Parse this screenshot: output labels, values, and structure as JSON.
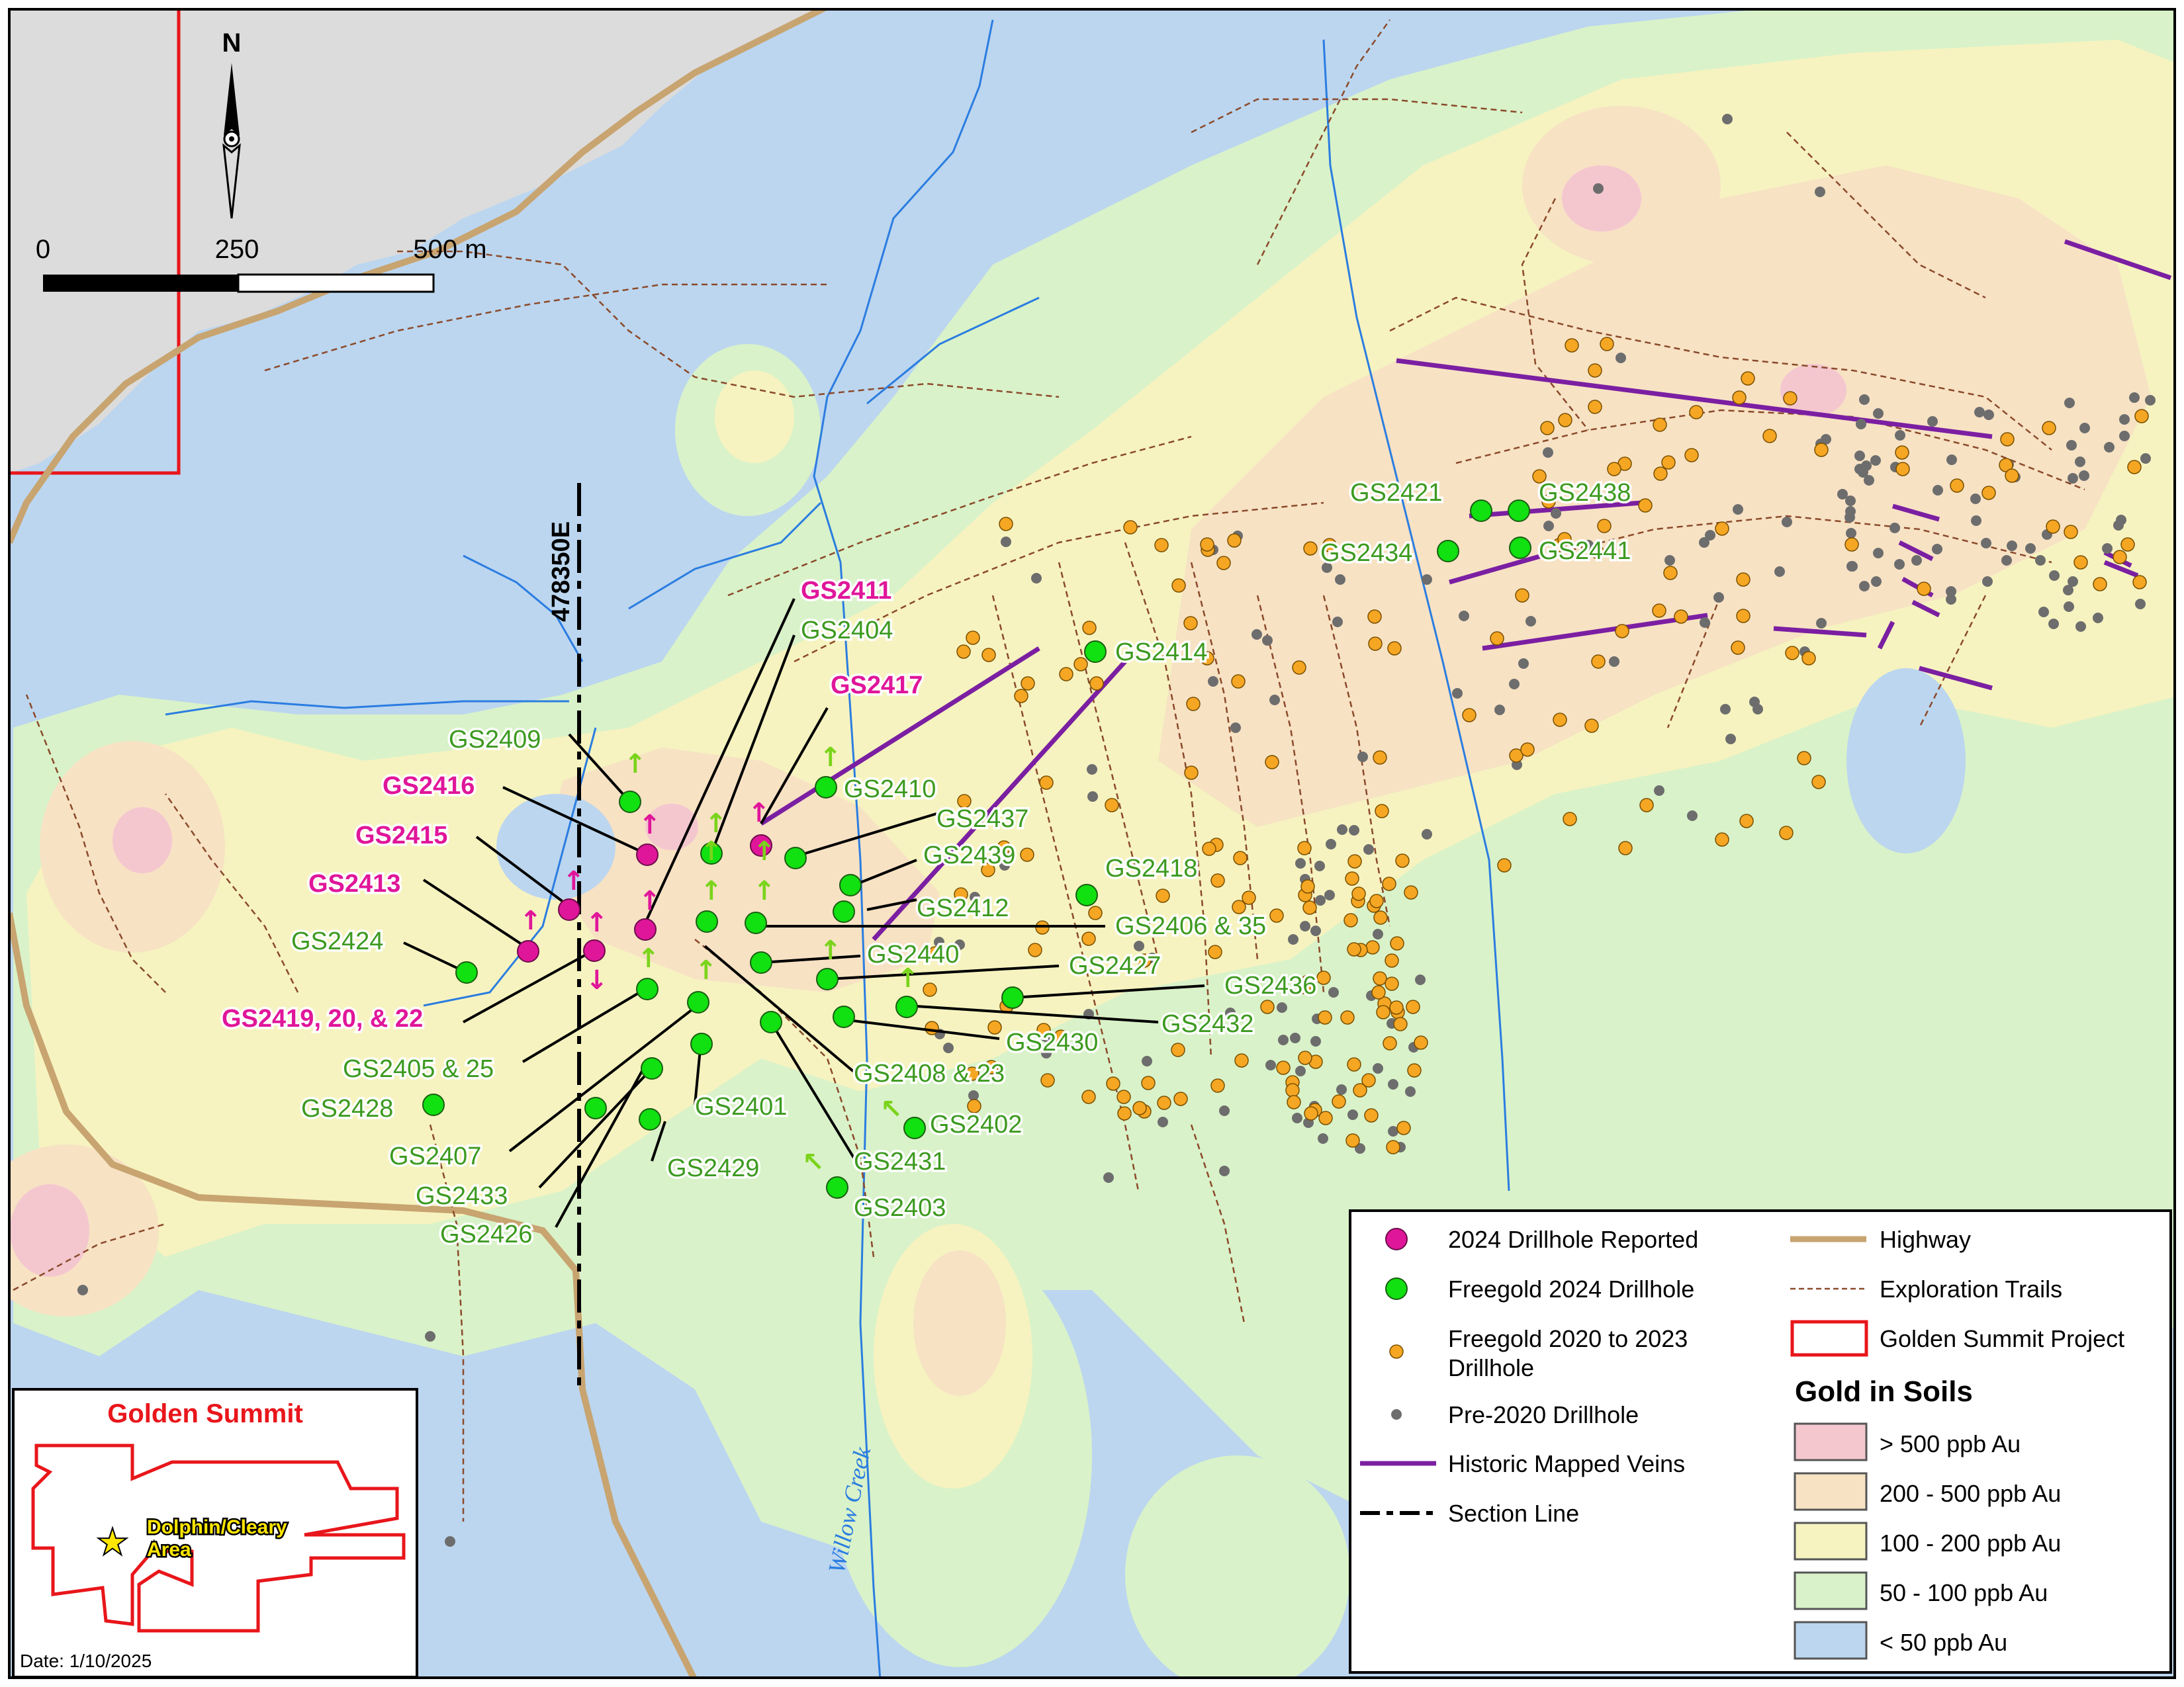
{
  "map": {
    "north_label": "N",
    "scale": {
      "t0": "0",
      "t1": "250",
      "t2": "500 m"
    },
    "section_label": "478350E",
    "creek_label": "Willow Creek"
  },
  "drillholes_2024_reported": [
    {
      "label": "GS2411"
    },
    {
      "label": "GS2417"
    },
    {
      "label": "GS2416"
    },
    {
      "label": "GS2415"
    },
    {
      "label": "GS2413"
    },
    {
      "label": "GS2419, 20, & 22"
    }
  ],
  "drillholes_freegold_2024": [
    {
      "label": "GS2404"
    },
    {
      "label": "GS2409"
    },
    {
      "label": "GS2414"
    },
    {
      "label": "GS2410"
    },
    {
      "label": "GS2437"
    },
    {
      "label": "GS2439"
    },
    {
      "label": "GS2418"
    },
    {
      "label": "GS2412"
    },
    {
      "label": "GS2406 & 35"
    },
    {
      "label": "GS2440"
    },
    {
      "label": "GS2427"
    },
    {
      "label": "GS2436"
    },
    {
      "label": "GS2432"
    },
    {
      "label": "GS2430"
    },
    {
      "label": "GS2424"
    },
    {
      "label": "GS2405 & 25"
    },
    {
      "label": "GS2408 & 23"
    },
    {
      "label": "GS2428"
    },
    {
      "label": "GS2401"
    },
    {
      "label": "GS2402"
    },
    {
      "label": "GS2407"
    },
    {
      "label": "GS2429"
    },
    {
      "label": "GS2431"
    },
    {
      "label": "GS2433"
    },
    {
      "label": "GS2403"
    },
    {
      "label": "GS2426"
    },
    {
      "label": "GS2421"
    },
    {
      "label": "GS2438"
    },
    {
      "label": "GS2434"
    },
    {
      "label": "GS2441"
    }
  ],
  "legend": {
    "items": [
      {
        "label": "2024 Drillhole Reported",
        "color": "#e0169a"
      },
      {
        "label": "Freegold 2024 Drillhole",
        "color": "#11e011"
      },
      {
        "label": "Freegold 2020 to 2023",
        "label2": "Drillhole",
        "color": "#f5a623"
      },
      {
        "label": "Pre-2020 Drillhole",
        "color": "#6d6d6d"
      },
      {
        "label": "Historic Mapped Veins",
        "color": "#7b1fa2"
      },
      {
        "label": "Section Line",
        "color": "#000000"
      },
      {
        "label": "Highway",
        "color": "#c8a470"
      },
      {
        "label": "Exploration Trails",
        "color": "#8b4a2b"
      },
      {
        "label": "Golden Summit Project",
        "color": "#e8161b"
      }
    ],
    "soils_title": "Gold in Soils",
    "soils": [
      {
        "label": "> 500 ppb Au",
        "color": "#f4c7cf"
      },
      {
        "label": "200 - 500 ppb Au",
        "color": "#f7e2c4"
      },
      {
        "label": "100 - 200 ppb Au",
        "color": "#f6f3c0"
      },
      {
        "label": "50 - 100 ppb Au",
        "color": "#d9f2c9"
      },
      {
        "label": "< 50 ppb Au",
        "color": "#bcd6ef"
      }
    ]
  },
  "inset": {
    "title": "Golden Summit",
    "area_line1": "Dolphin/Cleary",
    "area_line2": "Area",
    "date": "Date: 1/10/2025"
  }
}
